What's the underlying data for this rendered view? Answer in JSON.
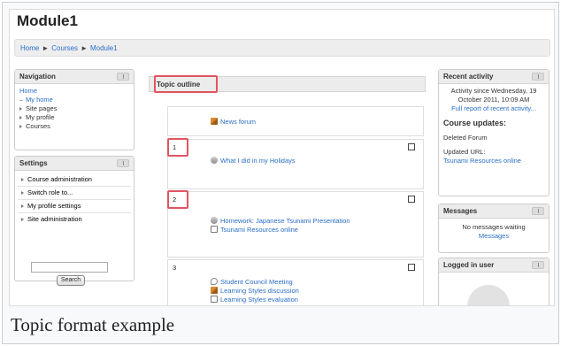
{
  "page": {
    "title": "Module1",
    "breadcrumb": [
      "Home",
      "Courses",
      "Module1"
    ],
    "caption": "Topic format example"
  },
  "navigation": {
    "title": "Navigation",
    "home": "Home",
    "items": [
      "My home",
      "Site pages",
      "My profile",
      "Courses"
    ]
  },
  "settings": {
    "title": "Settings",
    "items": [
      "Course administration",
      "Switch role to...",
      "My profile settings",
      "Site administration"
    ],
    "search_button": "Search"
  },
  "center": {
    "heading": "Topic outline",
    "sections": [
      {
        "number": "",
        "resources": [
          {
            "icon": "forum-icon",
            "label": "News forum"
          }
        ]
      },
      {
        "number": "1",
        "resources": [
          {
            "icon": "assignment-icon",
            "label": "What I did in my Holidays"
          }
        ]
      },
      {
        "number": "2",
        "resources": [
          {
            "icon": "assignment-icon",
            "label": "Homework: Japanese Tsunami Presentation"
          },
          {
            "icon": "url-icon",
            "label": "Tsunami Resources online"
          }
        ]
      },
      {
        "number": "3",
        "resources": [
          {
            "icon": "chat-icon",
            "label": "Student Council Meeting"
          },
          {
            "icon": "forum-icon",
            "label": "Learning Styles discussion"
          },
          {
            "icon": "url-icon",
            "label": "Learning Styles evaluation"
          }
        ]
      }
    ]
  },
  "recent": {
    "title": "Recent activity",
    "since_line1": "Activity since Wednesday, 19",
    "since_line2": "October 2011, 10:09 AM",
    "full_report": "Full report of recent activity...",
    "updates_heading": "Course updates:",
    "deleted": "Deleted Forum",
    "updated_url": "Updated URL:",
    "updated_link": "Tsunami Resources online"
  },
  "messages": {
    "title": "Messages",
    "line1": "No messages waiting",
    "link": "Messages"
  },
  "logged_in": {
    "title": "Logged in user"
  },
  "colors": {
    "link": "#2a6ec7",
    "highlight": "#e05560"
  }
}
